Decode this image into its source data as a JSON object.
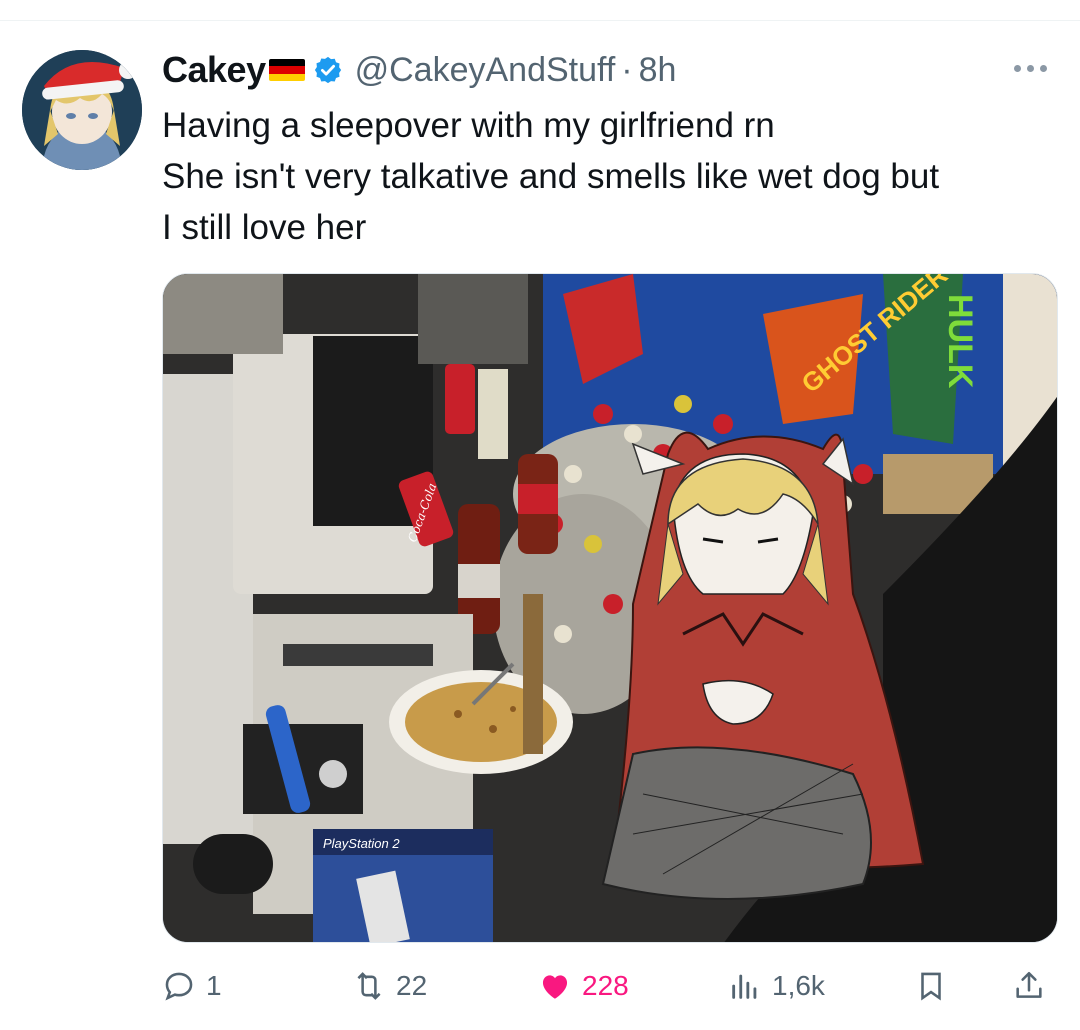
{
  "tweet": {
    "display_name": "Cakey",
    "handle": "@CakeyAndStuff",
    "separator": "·",
    "time": "8h",
    "text_lines": [
      "Having a sleepover with my girlfriend rn",
      "She isn't very talkative and smells like wet dog but",
      "I still love her"
    ]
  },
  "media": {
    "labels": {
      "playstation": "PlayStation 2",
      "ghost_rider": "GHOST RIDER",
      "hulk": "HULK",
      "coke": "Coca-Cola"
    }
  },
  "actions": {
    "replies": "1",
    "reposts": "22",
    "likes": "228",
    "views": "1,6k"
  },
  "colors": {
    "accent": "#1d9bf0",
    "like": "#f91880",
    "muted": "#536471"
  },
  "icons": [
    "verified-badge-icon",
    "german-flag-icon",
    "more-icon",
    "reply-icon",
    "repost-icon",
    "heart-icon",
    "views-icon",
    "bookmark-icon",
    "share-icon"
  ]
}
